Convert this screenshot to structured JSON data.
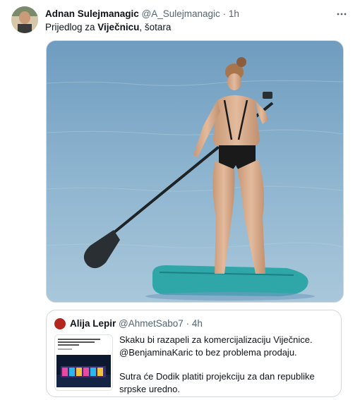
{
  "tweet": {
    "author_name": "Adnan Sulejmanagic",
    "author_handle": "@A_Sulejmanagic",
    "separator": "·",
    "time": "1h",
    "text_prefix": "Prijedlog za ",
    "text_bold": "Viječnicu",
    "text_suffix": ", šotara",
    "more_icon": "more-horizontal-icon"
  },
  "quoted_tweet": {
    "author_name": "Alija Lepir",
    "author_handle": "@AhmetSabo7",
    "separator": "·",
    "time": "4h",
    "lines": [
      "Skaku bi razapeli za komercijalizaciju Viječnice.",
      "@BenjaminaKaric to bez problema prodaju."
    ],
    "lines2": [
      "Sutra će Dodik platiti projekciju za dan republike",
      "srpske uredno."
    ]
  },
  "colors": {
    "text_primary": "#0f1419",
    "text_secondary": "#536471",
    "border": "#cfd9de",
    "water": "#8fb5cd",
    "board": "#2fa6a8"
  }
}
